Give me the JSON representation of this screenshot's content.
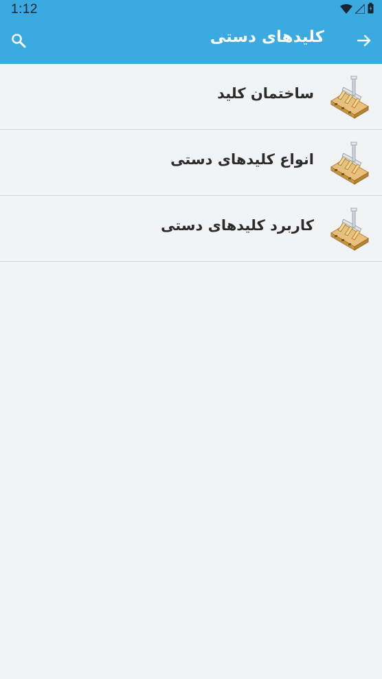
{
  "status_bar": {
    "time": "1:12",
    "icons": [
      "wifi-icon",
      "signal-icon",
      "battery-icon"
    ]
  },
  "app_bar": {
    "title": "کلیدهای دستی",
    "back_icon": "arrow-right-icon",
    "search_icon": "search-icon"
  },
  "list": {
    "items": [
      {
        "label": "ساختمان کلید",
        "icon": "knife-switch-icon"
      },
      {
        "label": "انواع کلیدهای دستی",
        "icon": "knife-switch-icon"
      },
      {
        "label": "کاربرد کلیدهای دستی",
        "icon": "knife-switch-icon"
      }
    ]
  },
  "colors": {
    "primary": "#3aaae0",
    "background": "#f2f3f5",
    "text": "#2b2b2b",
    "divider": "#d6d8db"
  }
}
